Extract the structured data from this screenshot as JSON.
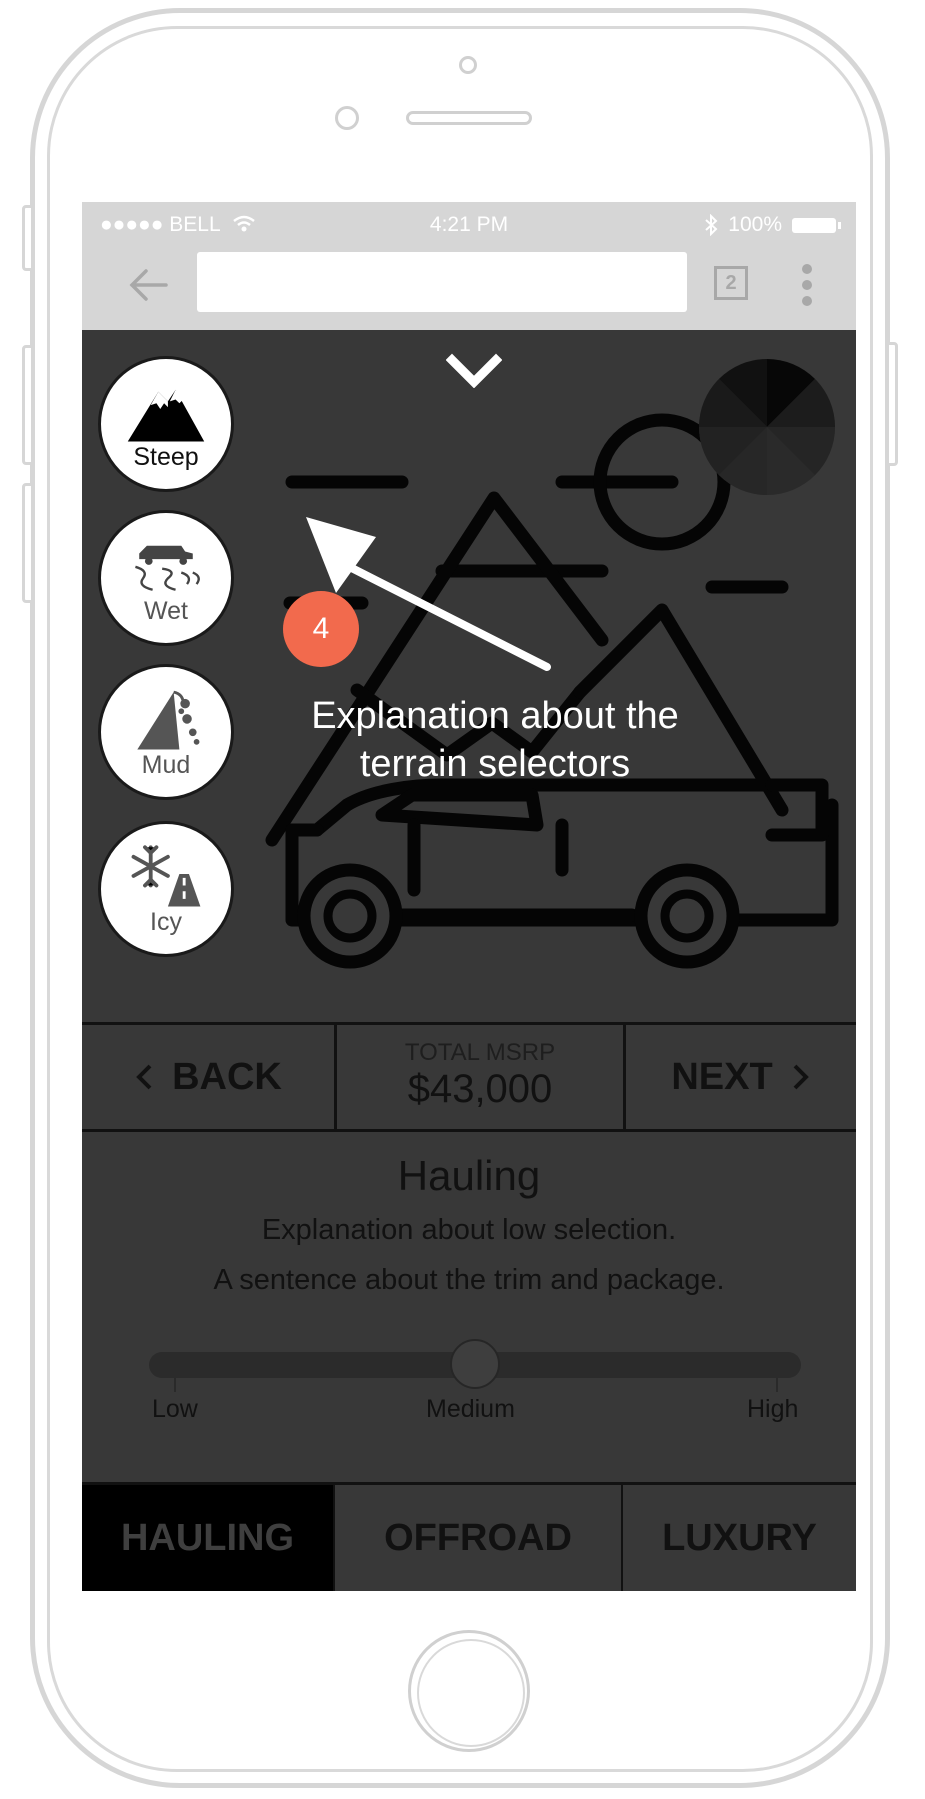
{
  "status_bar": {
    "carrier": "●●●●● BELL",
    "time": "4:21 PM",
    "battery": "100%"
  },
  "browser": {
    "tab_count": "2",
    "url": ""
  },
  "terrain": [
    {
      "label": "Steep",
      "icon": "mountain-icon"
    },
    {
      "label": "Wet",
      "icon": "wet-road-truck-icon"
    },
    {
      "label": "Mud",
      "icon": "landslide-icon"
    },
    {
      "label": "Icy",
      "icon": "snowflake-road-icon"
    }
  ],
  "coachmark": {
    "step": "4",
    "text": "Explanation about the terrain selectors"
  },
  "nav": {
    "back": "BACK",
    "price_caption": "TOTAL MSRP",
    "price": "$43,000",
    "next": "NEXT"
  },
  "description": {
    "title": "Hauling",
    "line1": "Explanation about low selection.",
    "line2": "A sentence about the trim and package."
  },
  "slider": {
    "labels": [
      "Low",
      "Medium",
      "High"
    ],
    "value": "Medium",
    "value_fraction": 0.5
  },
  "tabs": [
    {
      "label": "HAULING",
      "active": true
    },
    {
      "label": "OFFROAD",
      "active": false
    },
    {
      "label": "LUXURY",
      "active": false
    }
  ],
  "colors": {
    "screen_bg": "#383838",
    "badge": "#f26a4d",
    "chrome": "#d6d6d6"
  }
}
